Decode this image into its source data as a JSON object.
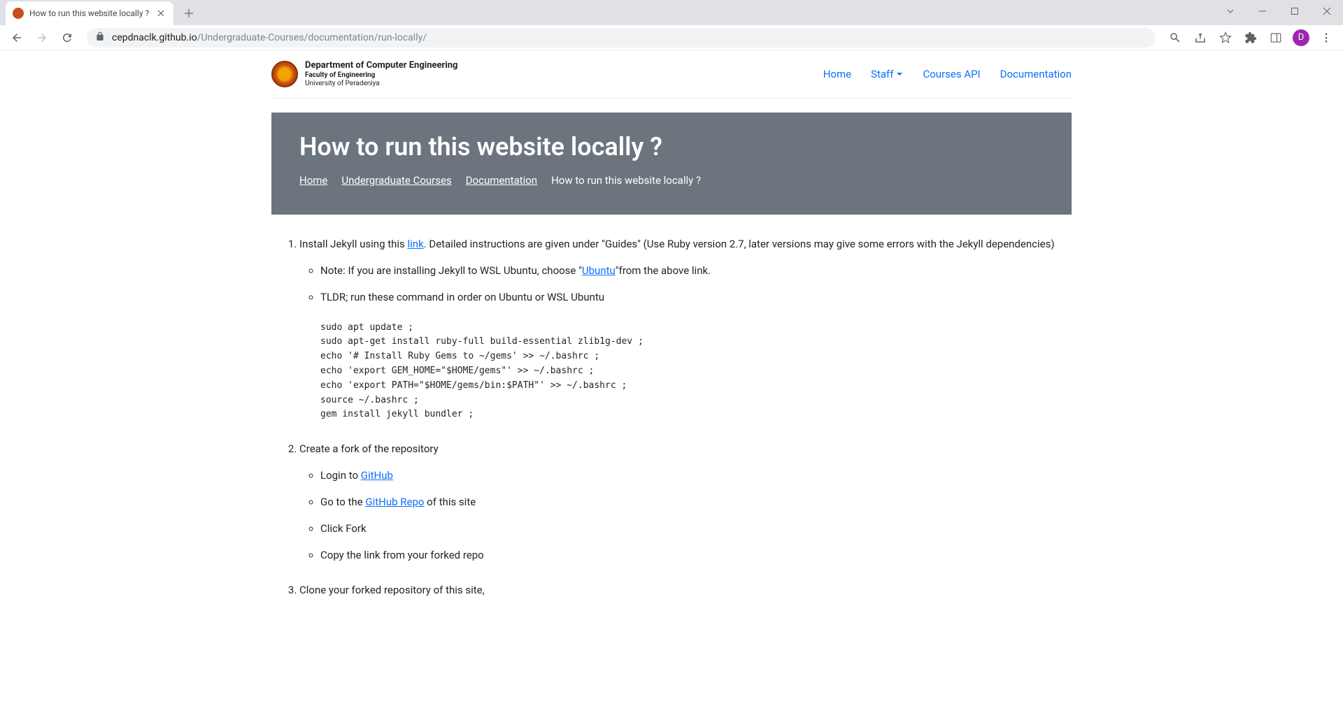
{
  "browser": {
    "tab_title": "How to run this website locally ?",
    "url_host": "cepdnaclk.github.io",
    "url_path": "/Undergraduate-Courses/documentation/run-locally/",
    "profile_letter": "D"
  },
  "site_header": {
    "title": "Department of Computer Engineering",
    "sub1": "Faculty of Engineering",
    "sub2": "University of Peradeniya",
    "nav": {
      "home": "Home",
      "staff": "Staff",
      "courses_api": "Courses API",
      "documentation": "Documentation"
    }
  },
  "hero": {
    "title": "How to run this website locally ?",
    "crumbs": {
      "home": "Home",
      "undergrad": "Undergraduate Courses",
      "doc": "Documentation",
      "current": "How to run this website locally ?"
    }
  },
  "content": {
    "step1_pre": "Install Jekyll using this ",
    "step1_link": "link",
    "step1_post": ". Detailed instructions are given under \"Guides\" (Use Ruby version 2.7, later versions may give some errors with the Jekyll dependencies)",
    "step1_note_pre": "Note: If you are installing Jekyll to WSL Ubuntu, choose \"",
    "step1_note_link": "Ubuntu",
    "step1_note_post": "\"from the above link.",
    "step1_tldr": "TLDR; run these command in order on Ubuntu or WSL Ubuntu",
    "code": "sudo apt update ;\nsudo apt-get install ruby-full build-essential zlib1g-dev ;\necho '# Install Ruby Gems to ~/gems' >> ~/.bashrc ;\necho 'export GEM_HOME=\"$HOME/gems\"' >> ~/.bashrc ;\necho 'export PATH=\"$HOME/gems/bin:$PATH\"' >> ~/.bashrc ;\nsource ~/.bashrc ;\ngem install jekyll bundler ;",
    "step2": "Create a fork of the repository",
    "step2_a_pre": "Login to ",
    "step2_a_link": "GitHub",
    "step2_b_pre": "Go to the ",
    "step2_b_link": "GitHub Repo",
    "step2_b_post": " of this site",
    "step2_c": "Click Fork",
    "step2_d": "Copy the link from your forked repo",
    "step3": "Clone your forked repository of this site,"
  }
}
